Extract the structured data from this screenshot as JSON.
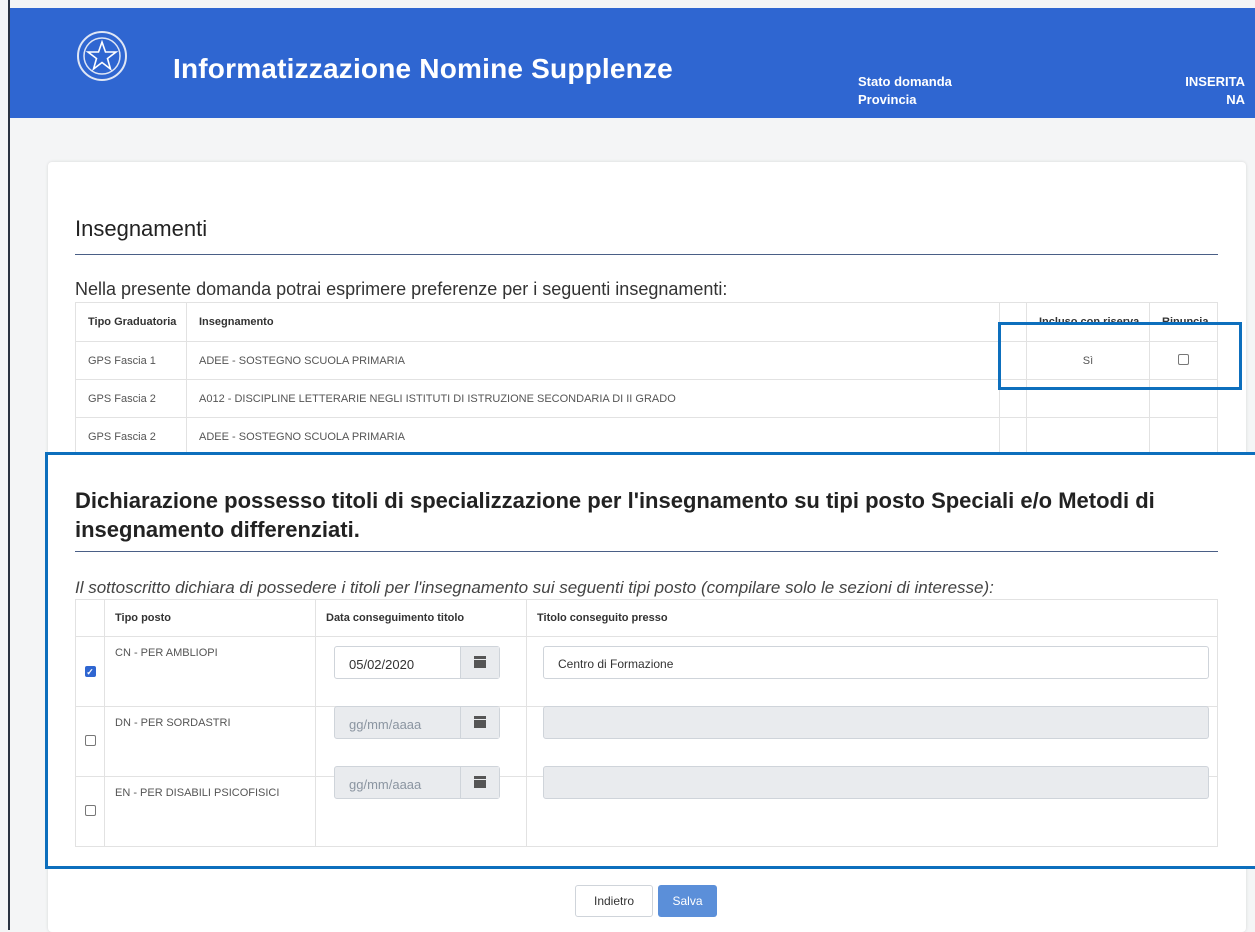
{
  "header": {
    "title": "Informatizzazione Nomine Supplenze",
    "stato_label": "Stato domanda",
    "stato_value": "INSERITA",
    "provincia_label": "Provincia",
    "provincia_value": "NA"
  },
  "insegnamenti": {
    "title": "Insegnamenti",
    "intro": "Nella presente domanda potrai esprimere preferenze per i seguenti insegnamenti:",
    "columns": [
      "Tipo Graduatoria",
      "Insegnamento",
      "",
      "Incluso con riserva",
      "Rinuncia"
    ],
    "rows": [
      {
        "tipo": "GPS Fascia 1",
        "insegnamento": "ADEE - SOSTEGNO SCUOLA PRIMARIA",
        "riserva": "Sì",
        "rinuncia": false
      },
      {
        "tipo": "GPS Fascia 2",
        "insegnamento": "A012 - DISCIPLINE LETTERARIE NEGLI ISTITUTI DI ISTRUZIONE SECONDARIA DI II GRADO",
        "riserva": "",
        "rinuncia": null
      },
      {
        "tipo": "GPS Fascia 2",
        "insegnamento": "ADEE - SOSTEGNO SCUOLA PRIMARIA",
        "riserva": "",
        "rinuncia": null
      }
    ]
  },
  "dichiarazione": {
    "title": "Dichiarazione possesso titoli di specializzazione per l'insegnamento su tipi posto Speciali e/o Metodi di insegnamento differenziati.",
    "intro": "Il sottoscritto dichiara di possedere i titoli per l'insegnamento sui seguenti tipi posto (compilare solo le sezioni di interesse):",
    "columns": [
      "",
      "Tipo posto",
      "Data conseguimento titolo",
      "Titolo conseguito presso"
    ],
    "rows": [
      {
        "checked": true,
        "tipo": "CN - PER AMBLIOPI",
        "data": "05/02/2020",
        "presso": "Centro di Formazione"
      },
      {
        "checked": false,
        "tipo": "DN - PER SORDASTRI",
        "data_placeholder": "gg/mm/aaaa",
        "presso": ""
      },
      {
        "checked": false,
        "tipo": "EN - PER DISABILI PSICOFISICI",
        "data_placeholder": "gg/mm/aaaa",
        "presso": ""
      }
    ]
  },
  "buttons": {
    "back": "Indietro",
    "save": "Salva"
  },
  "colors": {
    "header": "#2f66d1",
    "highlight": "#0d6fbd",
    "save": "#5b8fd9"
  }
}
